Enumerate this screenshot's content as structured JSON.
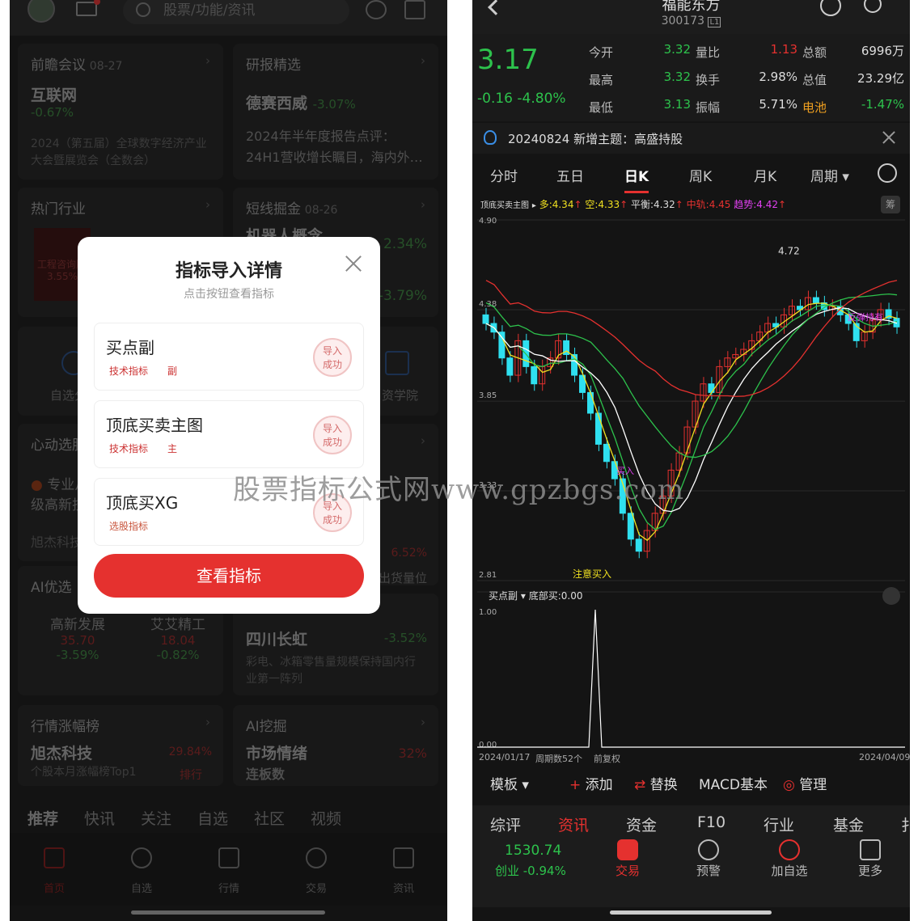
{
  "left": {
    "search_placeholder": "股票/功能/资讯",
    "cards": {
      "meeting": {
        "head": "前瞻会议",
        "date": "08-27",
        "name": "互联网",
        "change": "-0.67%",
        "desc": "2024（第五届）全球数字经济产业大会暨展览会（全数会）"
      },
      "research": {
        "head": "研报精选",
        "name": "德赛西威",
        "change": "-3.07%",
        "desc": "2024年半年度报告点评：24H1营收增长瞩目，海内外…"
      },
      "industry": {
        "head": "热门行业",
        "tile": "工程咨询服",
        "tile_pct": "3.55%"
      },
      "shortline": {
        "head": "短线掘金",
        "date": "08-26",
        "concept": "机器人概念",
        "pct1": "2.34%",
        "pct2": "-3.79%"
      },
      "selfpick": {
        "label": "自选分"
      },
      "school": {
        "label": "资学院"
      },
      "heart": {
        "head": "心动选股"
      },
      "pro": {
        "l1": "专业从",
        "l2": "级高新技",
        "l3": "旭杰科技"
      },
      "side": {
        "pct": "6.52%",
        "txt": "出货量位"
      },
      "ai": {
        "head": "AI优选",
        "s1": "高新发展",
        "p1": "35.70",
        "c1": "-3.59%",
        "s2": "艾艾精工",
        "p2": "18.04",
        "c2": "-0.82%"
      },
      "changhong": {
        "name": "四川长虹",
        "change": "-3.52%",
        "desc": "彩电、冰箱零售量规模保持国内行业第一阵列"
      },
      "rank": {
        "head": "行情涨幅榜",
        "name": "旭杰科技",
        "pct": "29.84%",
        "desc": "个股本月涨幅榜Top1",
        "more": "排行"
      },
      "aimine": {
        "head": "AI挖掘",
        "name": "市场情绪",
        "pct": "32%",
        "sub": "连板数"
      }
    },
    "tabs": [
      "推荐",
      "快讯",
      "关注",
      "自选",
      "社区",
      "视频"
    ],
    "nav": [
      "首页",
      "自选",
      "行情",
      "交易",
      "资讯"
    ]
  },
  "modal": {
    "title": "指标导入详情",
    "subtitle": "点击按钮查看指标",
    "items": [
      {
        "name": "买点副",
        "tag": "技术指标",
        "tag2": "副",
        "stamp_l1": "导入",
        "stamp_l2": "成功"
      },
      {
        "name": "顶底买卖主图",
        "tag": "技术指标",
        "tag2": "主",
        "stamp_l1": "导入",
        "stamp_l2": "成功"
      },
      {
        "name": "顶底买XG",
        "tag": "选股指标",
        "tag2": "",
        "stamp_l1": "导入",
        "stamp_l2": "成功"
      }
    ],
    "button": "查看指标"
  },
  "watermark": "股票指标公式网www.gpzbgs.com",
  "right": {
    "title": "福能东方",
    "code": "300173",
    "code_badge": "L1",
    "price": "3.17",
    "change": "-0.16",
    "change_pct": "-4.80%",
    "quote": [
      {
        "l": "今开",
        "v": "3.32",
        "l2": "量比",
        "v2": "1.13",
        "l3": "总额",
        "v3": "6996万"
      },
      {
        "l": "最高",
        "v": "3.32",
        "l2": "换手",
        "v2": "2.98%",
        "l3": "总值",
        "v3": "23.29亿"
      },
      {
        "l": "最低",
        "v": "3.13",
        "l2": "振幅",
        "v2": "5.71%",
        "l3": "电池",
        "v3": "-1.47%"
      }
    ],
    "notice": "20240824 新增主题：高盛持股",
    "period_tabs": [
      "分时",
      "五日",
      "日K",
      "周K",
      "月K",
      "周期"
    ],
    "indicator_name": "顶底买卖主图",
    "ind_values": [
      "多:4.34",
      "空:4.33",
      "平衡:4.32",
      "中轨:4.45",
      "趋势:4.42"
    ],
    "ind_badge": "筹",
    "y_ticks": [
      "4.90",
      "4.38",
      "3.85",
      "3.33",
      "2.81"
    ],
    "high_label": "4.72",
    "ann_pay_attention": "注意买入",
    "ann_buy": "买入",
    "ann_rebound": "反弹持有",
    "sub_indicator": "买点副",
    "sub_value": "底部买:0.00",
    "sub_ticks": [
      "1.00",
      "0.00"
    ],
    "date_start": "2024/01/17",
    "period_count": "周期数52个",
    "adjust": "前复权",
    "date_end": "2024/04/09",
    "toolbar": [
      "模板",
      "添加",
      "替换",
      "MACD基本",
      "管理"
    ],
    "func_tabs": [
      "综评",
      "资讯",
      "资金",
      "F10",
      "行业",
      "基金",
      "扌"
    ],
    "index_value": "1530.74",
    "index_label": "创业 -0.94%",
    "bottom_nav": [
      "交易",
      "预警",
      "加自选",
      "更多"
    ]
  },
  "colors": {
    "up": "#e5312f",
    "down": "#2dc24c",
    "accent": "#e5312f"
  },
  "chart_data": {
    "type": "candlestick",
    "x": [
      "2024/01/17",
      "2024/04/09"
    ],
    "ylim": [
      2.81,
      4.9
    ],
    "yticks": [
      4.9,
      4.38,
      3.85,
      3.33,
      2.81
    ],
    "high": 4.72,
    "sub_chart": {
      "name": "底部买",
      "ylim": [
        0,
        1
      ],
      "spike_value": 1.0
    }
  }
}
